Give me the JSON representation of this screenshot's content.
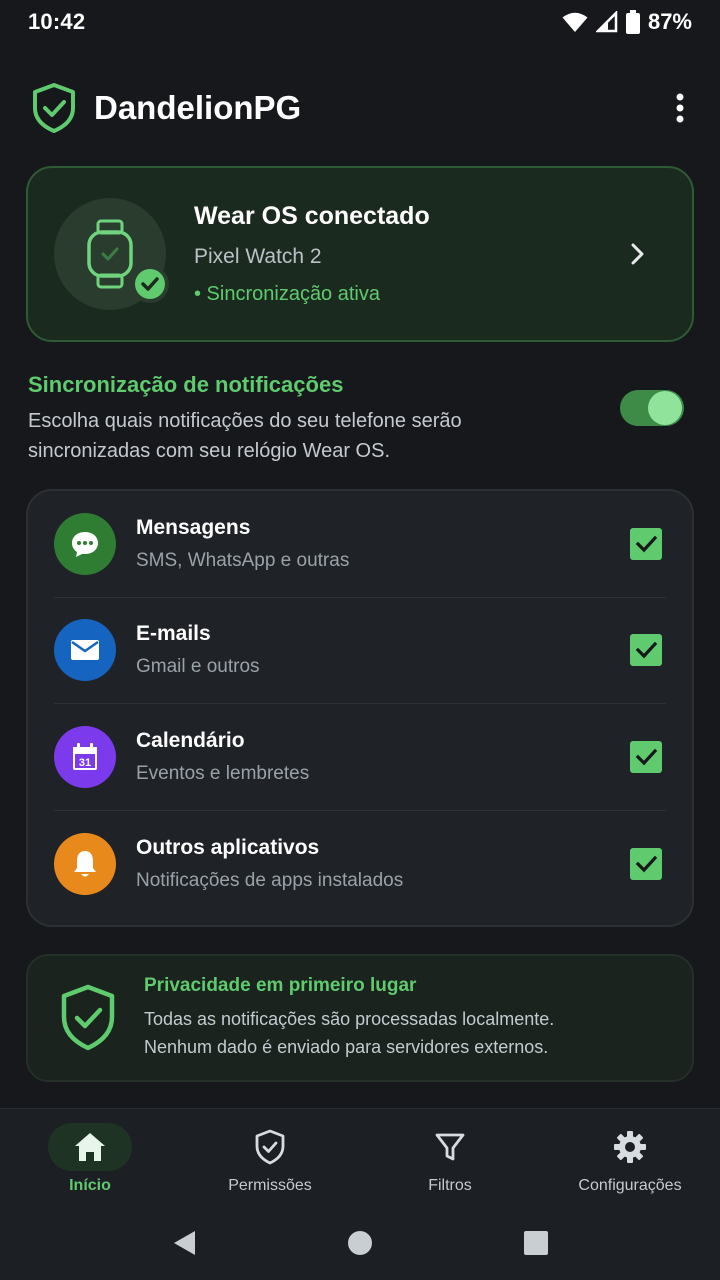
{
  "status_bar": {
    "time": "10:42",
    "battery_percent": "87%",
    "icons": [
      "wifi-icon",
      "cell-signal-icon",
      "battery-icon"
    ]
  },
  "app_bar": {
    "title": "DandelionPG",
    "logo_icon": "shield-check-icon",
    "menu_icon": "more-vert-icon"
  },
  "device": {
    "title": "Wear OS conectado",
    "model": "Pixel Watch 2",
    "status": "• Sincronização ativa",
    "icon": "smartwatch-icon"
  },
  "sync": {
    "title": "Sincronização de notificações",
    "description": "Escolha quais notificações do seu telefone serão sincronizadas com seu relógio Wear OS.",
    "enabled": true
  },
  "categories": [
    {
      "title": "Mensagens",
      "subtitle": "SMS, WhatsApp e outras",
      "icon": "chat-bubble-icon",
      "color": "#2e7d32",
      "checked": true
    },
    {
      "title": "E-mails",
      "subtitle": "Gmail e outros",
      "icon": "mail-icon",
      "color": "#1565c0",
      "checked": true
    },
    {
      "title": "Calendário",
      "subtitle": "Eventos e lembretes",
      "icon": "calendar-icon",
      "color": "#7c3aed",
      "checked": true
    },
    {
      "title": "Outros aplicativos",
      "subtitle": "Notificações de apps instalados",
      "icon": "bell-icon",
      "color": "#e8891c",
      "checked": true
    }
  ],
  "privacy": {
    "title": "Privacidade em primeiro lugar",
    "line1": "Todas as notificações são processadas localmente.",
    "line2": "Nenhum dado é enviado para servidores externos."
  },
  "bottom_nav": [
    {
      "label": "Início",
      "icon": "home-icon",
      "active": true
    },
    {
      "label": "Permissões",
      "icon": "shield-check-icon",
      "active": false
    },
    {
      "label": "Filtros",
      "icon": "filter-icon",
      "active": false
    },
    {
      "label": "Configurações",
      "icon": "gear-icon",
      "active": false
    }
  ],
  "colors": {
    "accent": "#5fca6e",
    "background": "#16181b",
    "card": "#1f2226"
  }
}
